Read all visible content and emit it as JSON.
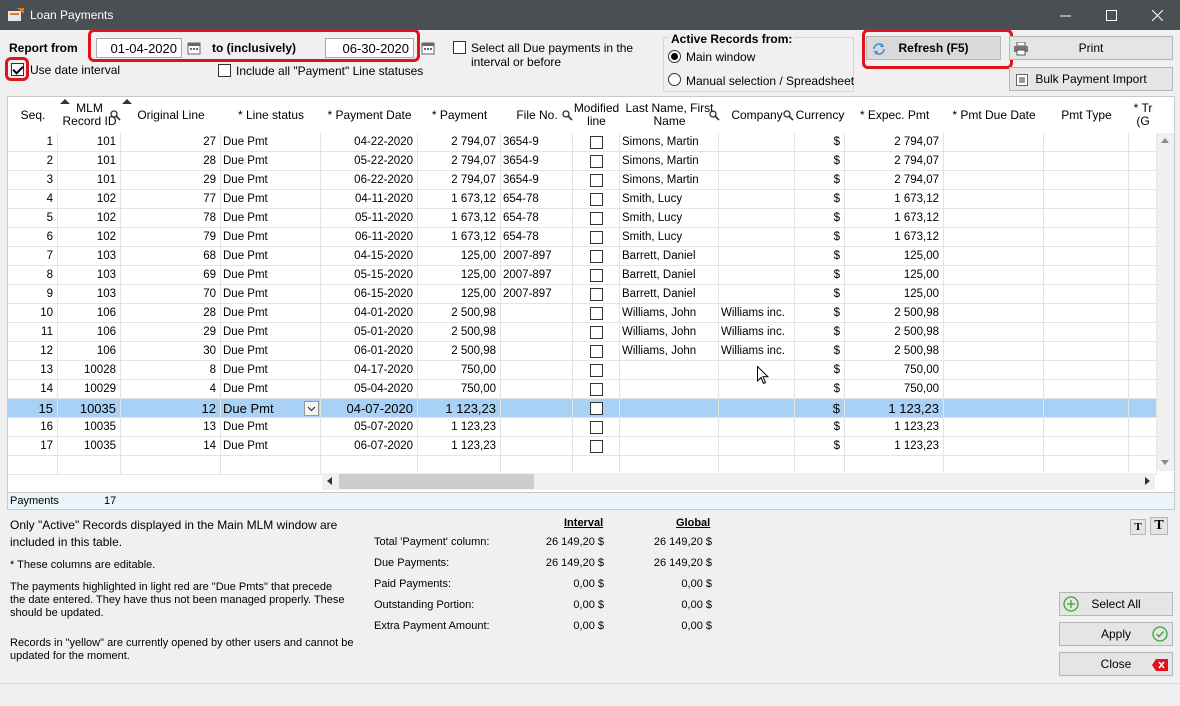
{
  "window": {
    "title": "Loan Payments"
  },
  "filters": {
    "report_from_label": "Report from",
    "from_date": "01-04-2020",
    "to_label": "to (inclusively)",
    "to_date": "06-30-2020",
    "use_date_interval_label": "Use date interval",
    "use_date_interval_checked": true,
    "include_all_label": "Include all \"Payment\" Line statuses",
    "select_all_due_label": "Select all Due payments in the interval or before"
  },
  "active_records": {
    "title": "Active Records from:",
    "option_main": "Main window",
    "option_manual": "Manual selection / Spreadsheet",
    "selected": "main"
  },
  "buttons": {
    "refresh": "Refresh (F5)",
    "print": "Print",
    "bulk_import": "Bulk Payment Import",
    "select_all": "Select All",
    "apply": "Apply",
    "close": "Close"
  },
  "grid": {
    "columns": {
      "seq": "Seq.",
      "mlm_id": "MLM Record ID",
      "orig_line": "Original Line",
      "line_status": "* Line status",
      "pay_date": "* Payment Date",
      "payment": "* Payment",
      "file_no": "File No.",
      "modified": "Modified line",
      "name": "Last Name, First Name",
      "company": "Company",
      "currency": "Currency",
      "exp_pmt": "* Expec. Pmt",
      "due_date": "* Pmt Due Date",
      "pmt_type": "Pmt Type",
      "extra": "* Tr (G"
    },
    "rows": [
      {
        "seq": "1",
        "mlm": "101",
        "orig": "27",
        "status": "Due Pmt",
        "date": "04-22-2020",
        "payment": "2 794,07",
        "file": "3654-9",
        "name": "Simons, Martin",
        "company": "",
        "cur": "$",
        "exp": "2 794,07"
      },
      {
        "seq": "2",
        "mlm": "101",
        "orig": "28",
        "status": "Due Pmt",
        "date": "05-22-2020",
        "payment": "2 794,07",
        "file": "3654-9",
        "name": "Simons, Martin",
        "company": "",
        "cur": "$",
        "exp": "2 794,07"
      },
      {
        "seq": "3",
        "mlm": "101",
        "orig": "29",
        "status": "Due Pmt",
        "date": "06-22-2020",
        "payment": "2 794,07",
        "file": "3654-9",
        "name": "Simons, Martin",
        "company": "",
        "cur": "$",
        "exp": "2 794,07"
      },
      {
        "seq": "4",
        "mlm": "102",
        "orig": "77",
        "status": "Due Pmt",
        "date": "04-11-2020",
        "payment": "1 673,12",
        "file": "654-78",
        "name": "Smith, Lucy",
        "company": "",
        "cur": "$",
        "exp": "1 673,12"
      },
      {
        "seq": "5",
        "mlm": "102",
        "orig": "78",
        "status": "Due Pmt",
        "date": "05-11-2020",
        "payment": "1 673,12",
        "file": "654-78",
        "name": "Smith, Lucy",
        "company": "",
        "cur": "$",
        "exp": "1 673,12"
      },
      {
        "seq": "6",
        "mlm": "102",
        "orig": "79",
        "status": "Due Pmt",
        "date": "06-11-2020",
        "payment": "1 673,12",
        "file": "654-78",
        "name": "Smith, Lucy",
        "company": "",
        "cur": "$",
        "exp": "1 673,12"
      },
      {
        "seq": "7",
        "mlm": "103",
        "orig": "68",
        "status": "Due Pmt",
        "date": "04-15-2020",
        "payment": "125,00",
        "file": "2007-897",
        "name": "Barrett, Daniel",
        "company": "",
        "cur": "$",
        "exp": "125,00"
      },
      {
        "seq": "8",
        "mlm": "103",
        "orig": "69",
        "status": "Due Pmt",
        "date": "05-15-2020",
        "payment": "125,00",
        "file": "2007-897",
        "name": "Barrett, Daniel",
        "company": "",
        "cur": "$",
        "exp": "125,00"
      },
      {
        "seq": "9",
        "mlm": "103",
        "orig": "70",
        "status": "Due Pmt",
        "date": "06-15-2020",
        "payment": "125,00",
        "file": "2007-897",
        "name": "Barrett, Daniel",
        "company": "",
        "cur": "$",
        "exp": "125,00"
      },
      {
        "seq": "10",
        "mlm": "106",
        "orig": "28",
        "status": "Due Pmt",
        "date": "04-01-2020",
        "payment": "2 500,98",
        "file": "",
        "name": "Williams, John",
        "company": "Williams inc.",
        "cur": "$",
        "exp": "2 500,98"
      },
      {
        "seq": "11",
        "mlm": "106",
        "orig": "29",
        "status": "Due Pmt",
        "date": "05-01-2020",
        "payment": "2 500,98",
        "file": "",
        "name": "Williams, John",
        "company": "Williams inc.",
        "cur": "$",
        "exp": "2 500,98"
      },
      {
        "seq": "12",
        "mlm": "106",
        "orig": "30",
        "status": "Due Pmt",
        "date": "06-01-2020",
        "payment": "2 500,98",
        "file": "",
        "name": "Williams, John",
        "company": "Williams inc.",
        "cur": "$",
        "exp": "2 500,98"
      },
      {
        "seq": "13",
        "mlm": "10028",
        "orig": "8",
        "status": "Due Pmt",
        "date": "04-17-2020",
        "payment": "750,00",
        "file": "",
        "name": "",
        "company": "",
        "cur": "$",
        "exp": "750,00"
      },
      {
        "seq": "14",
        "mlm": "10029",
        "orig": "4",
        "status": "Due Pmt",
        "date": "05-04-2020",
        "payment": "750,00",
        "file": "",
        "name": "",
        "company": "",
        "cur": "$",
        "exp": "750,00"
      },
      {
        "seq": "15",
        "mlm": "10035",
        "orig": "12",
        "status": "Due Pmt",
        "date": "04-07-2020",
        "payment": "1 123,23",
        "file": "",
        "name": "",
        "company": "",
        "cur": "$",
        "exp": "1 123,23"
      },
      {
        "seq": "16",
        "mlm": "10035",
        "orig": "13",
        "status": "Due Pmt",
        "date": "05-07-2020",
        "payment": "1 123,23",
        "file": "",
        "name": "",
        "company": "",
        "cur": "$",
        "exp": "1 123,23"
      },
      {
        "seq": "17",
        "mlm": "10035",
        "orig": "14",
        "status": "Due Pmt",
        "date": "06-07-2020",
        "payment": "1 123,23",
        "file": "",
        "name": "",
        "company": "",
        "cur": "$",
        "exp": "1 123,23"
      }
    ],
    "selected_seq": "15",
    "footer_label": "Payments",
    "footer_count": "17"
  },
  "notes": {
    "active_note": "Only \"Active\" Records displayed in the Main MLM window are included in this table.",
    "editable_note": "* These columns are editable.",
    "red_note": "The payments highlighted in light red are \"Due Pmts\" that precede the date entered. They have thus not been managed properly. These should be updated.",
    "yellow_note": "Records in \"yellow\" are currently opened by other users and cannot be updated for the moment."
  },
  "summary": {
    "interval_header": "Interval",
    "global_header": "Global",
    "rows": [
      {
        "label": "Total 'Payment' column:",
        "interval": "26 149,20 $",
        "global": "26 149,20 $"
      },
      {
        "label": "Due Payments:",
        "interval": "26 149,20 $",
        "global": "26 149,20 $"
      },
      {
        "label": "Paid Payments:",
        "interval": "0,00 $",
        "global": "0,00 $"
      },
      {
        "label": "Outstanding Portion:",
        "interval": "0,00 $",
        "global": "0,00 $"
      },
      {
        "label": "Extra Payment Amount:",
        "interval": "0,00 $",
        "global": "0,00 $"
      }
    ]
  },
  "font_buttons": {
    "small": "T",
    "large": "T"
  },
  "colors": {
    "titlebar": "#4a4f54",
    "selected_row": "#a9d1f5",
    "highlight": "#e0121e",
    "accent_green": "#3aa33a"
  }
}
